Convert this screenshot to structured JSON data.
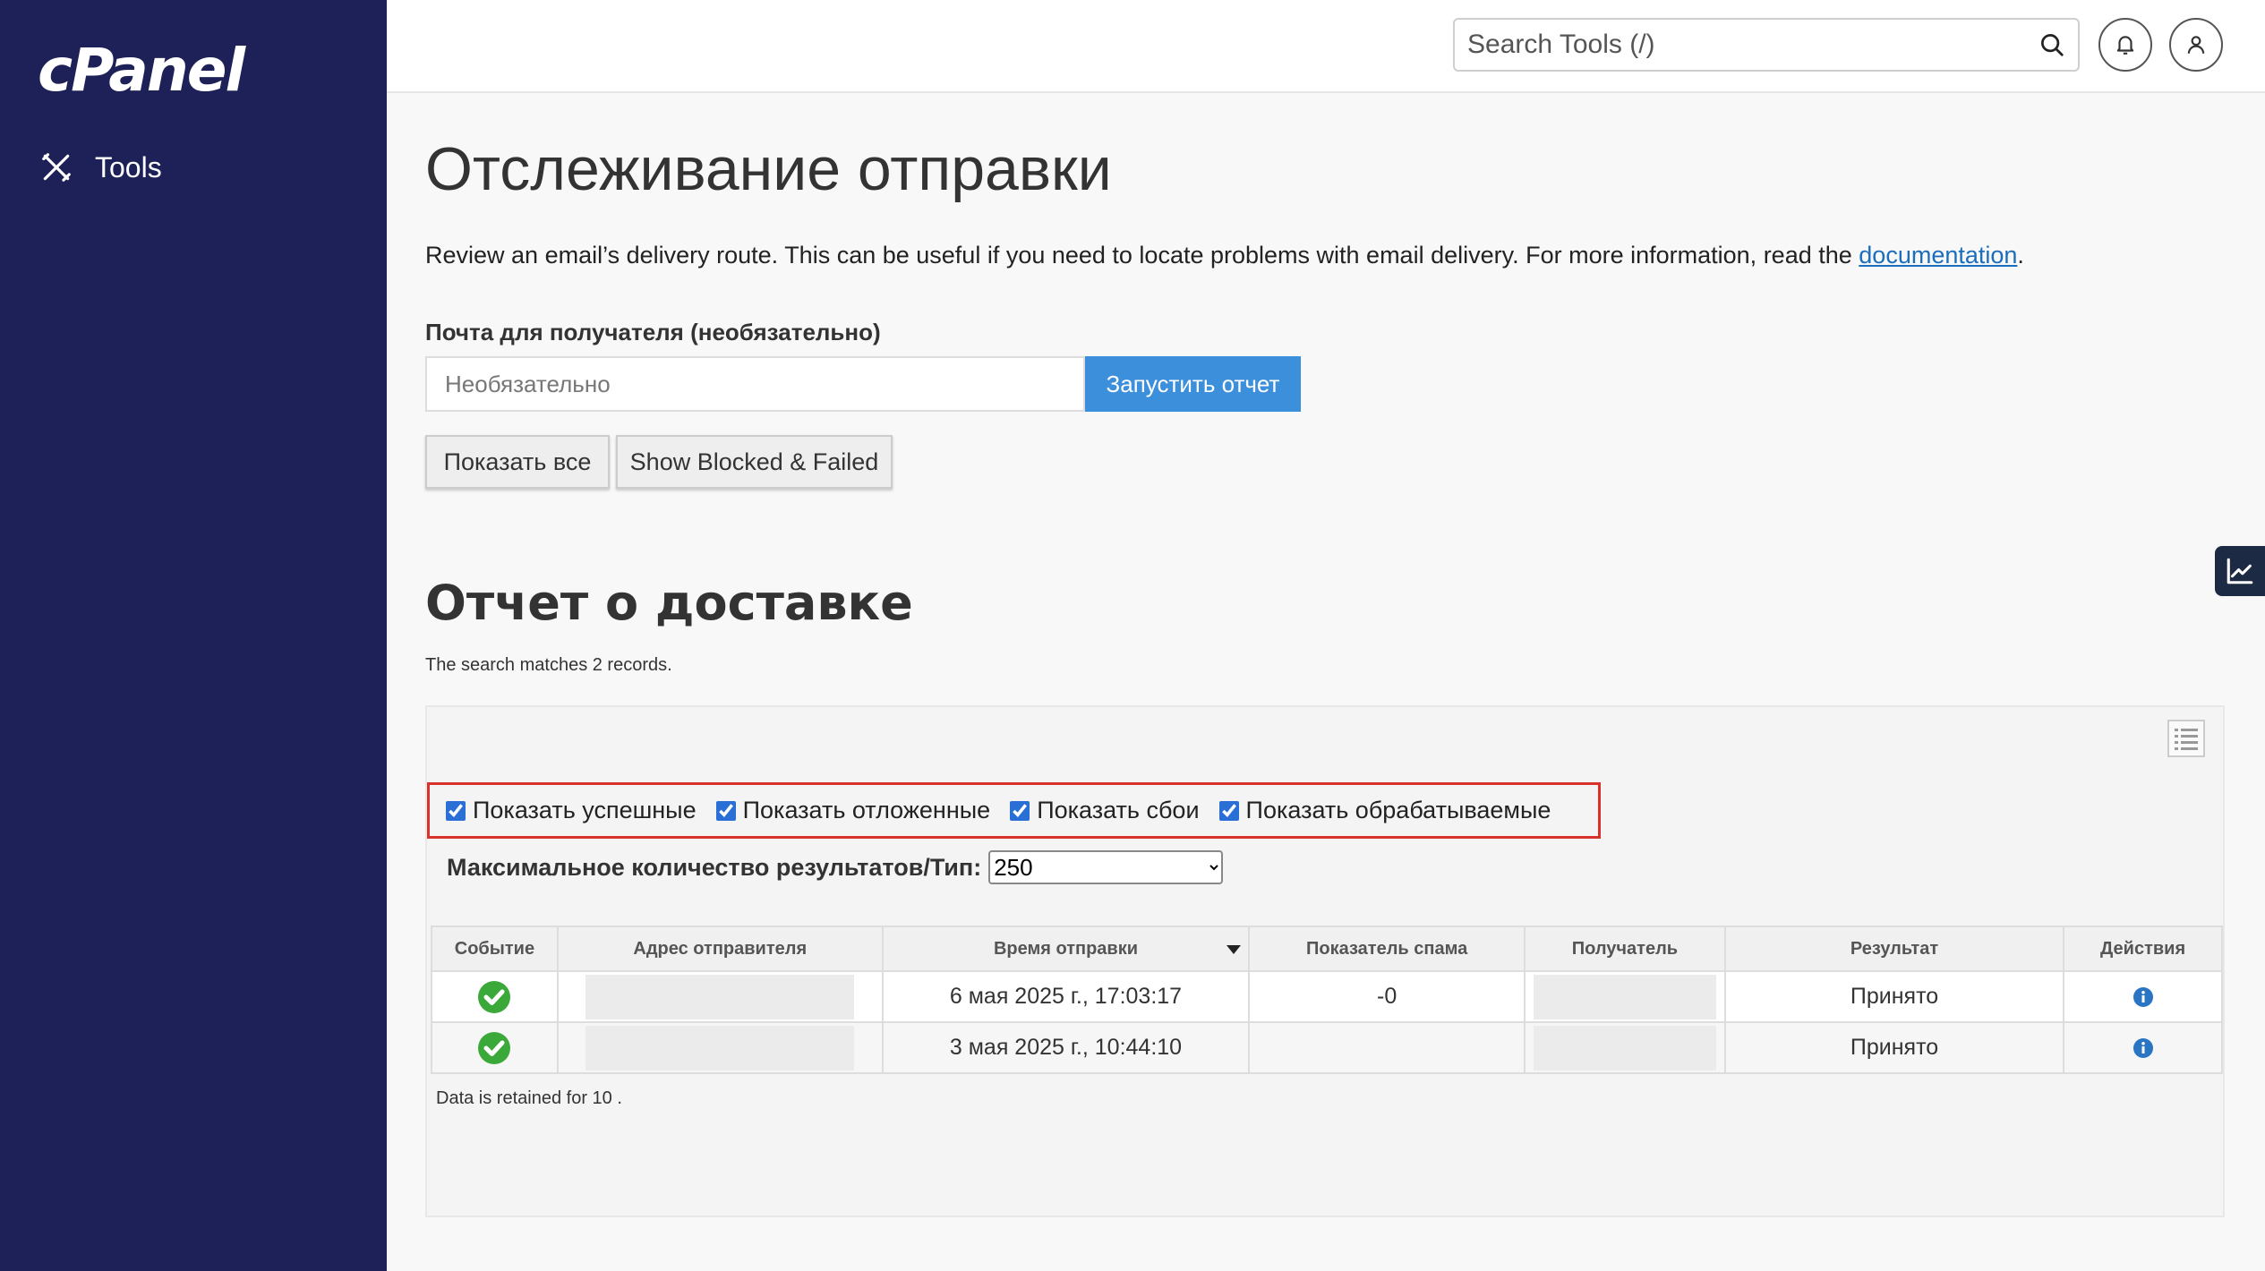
{
  "sidebar": {
    "logo": "cPanel",
    "nav": [
      {
        "label": "Tools",
        "icon": "tools-icon"
      }
    ]
  },
  "header": {
    "search_placeholder": "Search Tools (/)",
    "icons": [
      "search-icon",
      "bell-icon",
      "user-icon"
    ]
  },
  "page": {
    "title": "Отслеживание отправки",
    "description_text": "Review an email’s delivery route. This can be useful if you need to locate problems with email delivery. For more information, read the ",
    "description_link": "documentation",
    "description_end": "."
  },
  "form": {
    "recipient_label": "Почта для получателя (необязательно)",
    "recipient_placeholder": "Необязательно",
    "run_button": "Запустить отчет",
    "show_all_button": "Показать все",
    "show_blocked_button": "Show Blocked & Failed"
  },
  "report": {
    "title": "Отчет о доставке",
    "match_text": "The search matches 2 records.",
    "filters": [
      {
        "label": "Показать успешные",
        "checked": true
      },
      {
        "label": "Показать отложенные",
        "checked": true
      },
      {
        "label": "Показать сбои",
        "checked": true
      },
      {
        "label": "Показать обрабатываемые",
        "checked": true
      }
    ],
    "max_label": "Максимальное количество результатов/Тип:",
    "max_value": "250",
    "columns": [
      "Событие",
      "Адрес отправителя",
      "Время отправки",
      "Показатель спама",
      "Получатель",
      "Результат",
      "Действия"
    ],
    "rows": [
      {
        "event": "success",
        "sender": "",
        "time": "6 мая 2025 г., 17:03:17",
        "spam": "-0",
        "recipient": "",
        "result": "Принято",
        "action": "info-icon"
      },
      {
        "event": "success",
        "sender": "",
        "time": "3 мая 2025 г., 10:44:10",
        "spam": "",
        "recipient": "",
        "result": "Принято",
        "action": "info-icon"
      }
    ],
    "retention": "Data is retained for 10 ."
  },
  "colors": {
    "sidebar_bg": "#1d2157",
    "primary_button": "#3b8fdb",
    "highlight_border": "#d9312b",
    "success_green": "#3aa93a",
    "info_blue": "#2a74c4",
    "link": "#1a6ebd"
  }
}
